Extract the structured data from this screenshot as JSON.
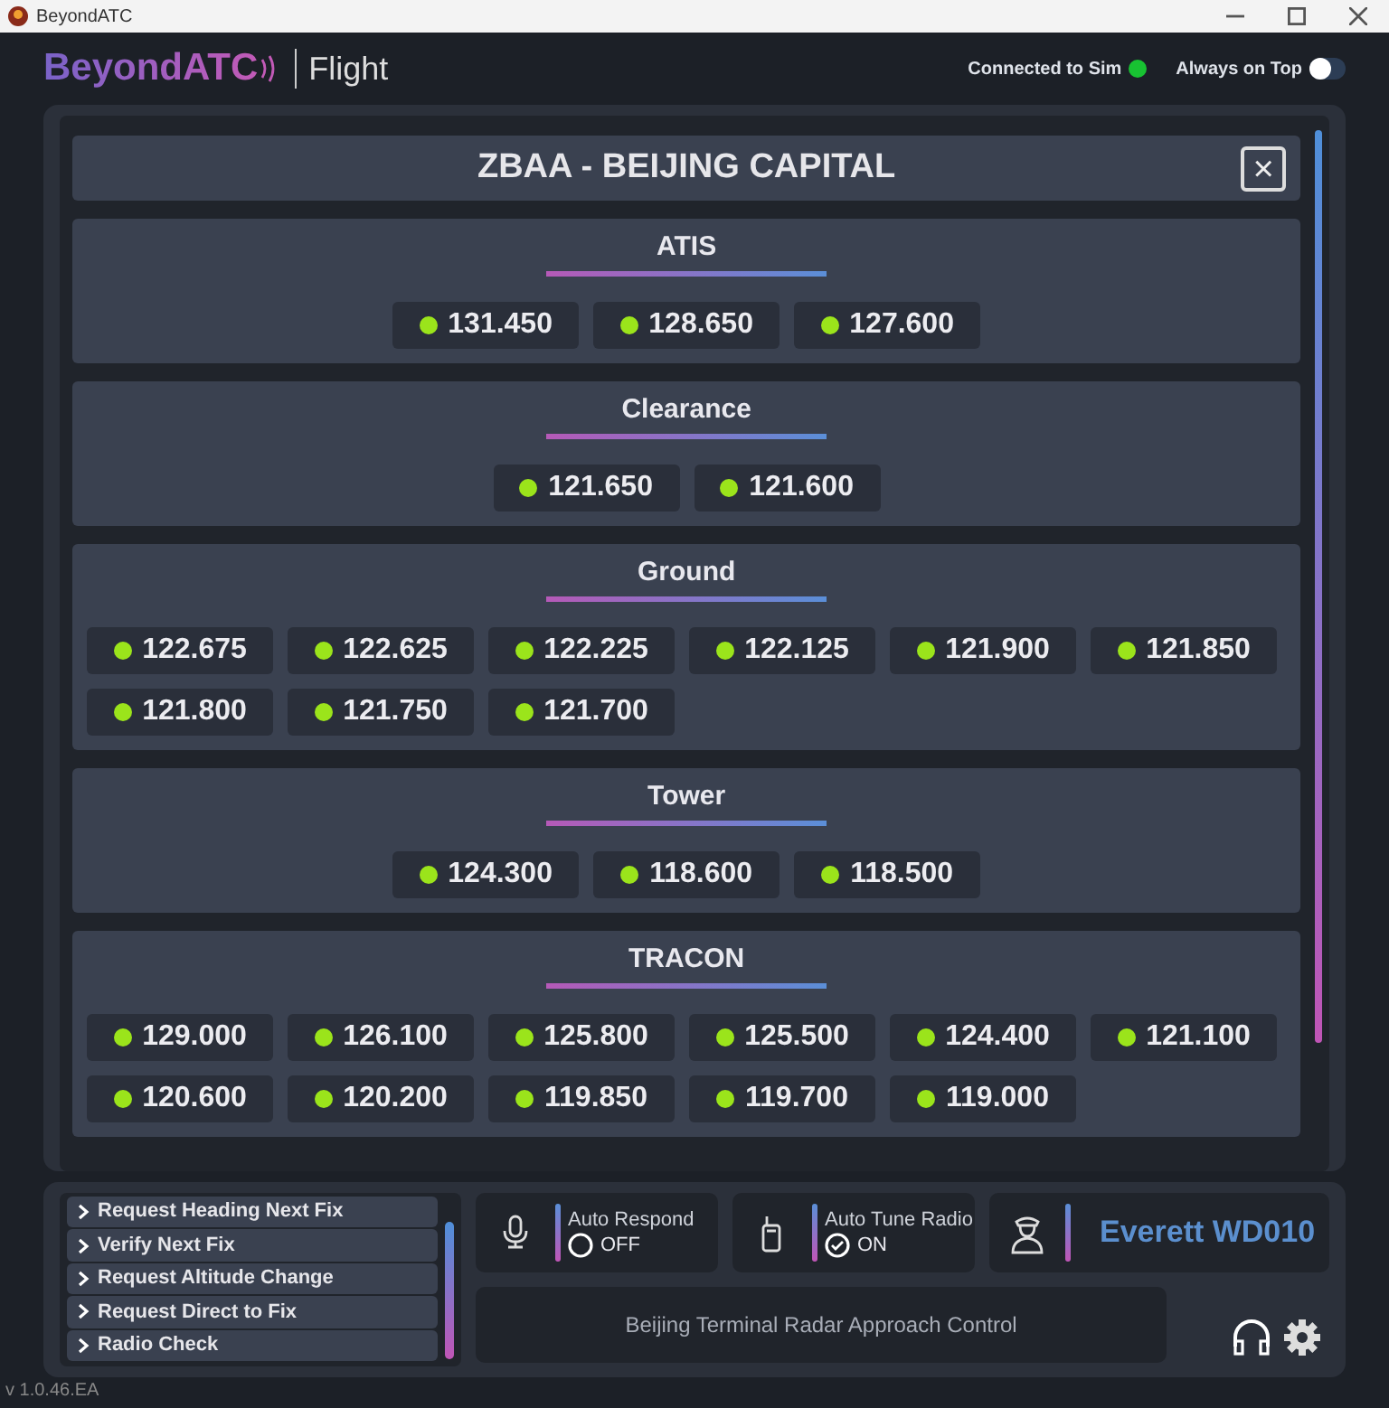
{
  "window": {
    "title": "BeyondATC"
  },
  "header": {
    "logo": "BeyondATC",
    "mode": "Flight",
    "connection": {
      "label": "Connected to Sim",
      "connected": true
    },
    "always_on_top": {
      "label": "Always on Top",
      "on": false
    }
  },
  "airport": {
    "title": "ZBAA - BEIJING CAPITAL",
    "close": "×"
  },
  "sections": [
    {
      "title": "ATIS",
      "frequencies": [
        "131.450",
        "128.650",
        "127.600"
      ]
    },
    {
      "title": "Clearance",
      "frequencies": [
        "121.650",
        "121.600"
      ]
    },
    {
      "title": "Ground",
      "frequencies": [
        "122.675",
        "122.625",
        "122.225",
        "122.125",
        "121.900",
        "121.850",
        "121.800",
        "121.750",
        "121.700"
      ]
    },
    {
      "title": "Tower",
      "frequencies": [
        "124.300",
        "118.600",
        "118.500"
      ]
    },
    {
      "title": "TRACON",
      "frequencies": [
        "129.000",
        "126.100",
        "125.800",
        "125.500",
        "124.400",
        "121.100",
        "120.600",
        "120.200",
        "119.850",
        "119.700",
        "119.000"
      ]
    }
  ],
  "commands": [
    "Request Heading Next Fix",
    "Verify Next Fix",
    "Request Altitude Change",
    "Request Direct to Fix",
    "Radio Check"
  ],
  "toggles": [
    {
      "kind": "microphone",
      "label": "Auto Respond",
      "state": "OFF",
      "on": false
    },
    {
      "kind": "radio",
      "label": "Auto Tune Radio",
      "state": "ON",
      "on": true
    }
  ],
  "controller": {
    "name": "Everett WD010"
  },
  "facility": "Beijing Terminal Radar Approach Control",
  "version": "v 1.0.46.EA"
}
